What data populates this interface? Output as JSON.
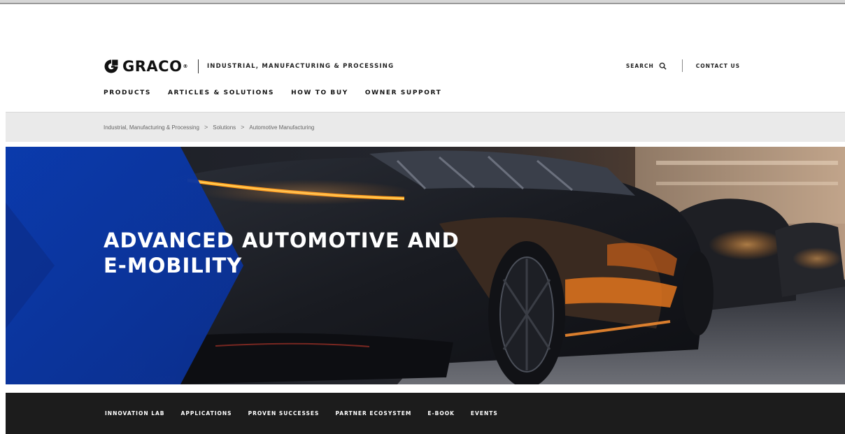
{
  "brand": {
    "logo_text": "GRACO",
    "reg_mark": "®",
    "section": "INDUSTRIAL, MANUFACTURING & PROCESSING"
  },
  "utility": {
    "search_label": "SEARCH",
    "contact_label": "CONTACT US"
  },
  "main_nav": {
    "items": [
      {
        "label": "PRODUCTS"
      },
      {
        "label": "ARTICLES & SOLUTIONS"
      },
      {
        "label": "HOW TO BUY"
      },
      {
        "label": "OWNER SUPPORT"
      }
    ]
  },
  "breadcrumb": {
    "items": [
      {
        "label": "Industrial, Manufacturing & Processing"
      },
      {
        "label": "Solutions"
      },
      {
        "label": "Automotive Manufacturing"
      }
    ],
    "separator": ">"
  },
  "hero": {
    "title_line1": "ADVANCED AUTOMOTIVE AND",
    "title_line2": "E-MOBILITY"
  },
  "sub_nav": {
    "items": [
      {
        "label": "INNOVATION LAB"
      },
      {
        "label": "APPLICATIONS"
      },
      {
        "label": "PROVEN SUCCESSES"
      },
      {
        "label": "PARTNER ECOSYSTEM"
      },
      {
        "label": "E-BOOK"
      },
      {
        "label": "EVENTS"
      }
    ]
  },
  "colors": {
    "brand_blue": "#0a3bb0",
    "accent_orange": "#e0741e",
    "dark_bar": "#1c1c1c"
  },
  "icons": {
    "logo": "graco-logo-icon",
    "search": "search-icon"
  }
}
